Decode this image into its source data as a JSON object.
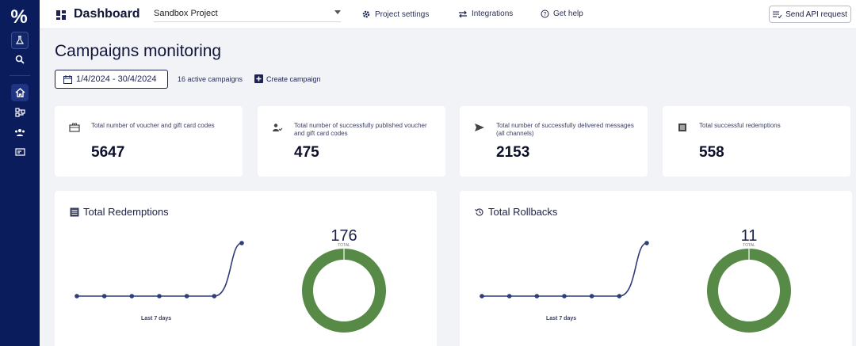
{
  "sidebar": {
    "logo": "%"
  },
  "topbar": {
    "title": "Dashboard",
    "project": "Sandbox Project",
    "links": {
      "project_settings": "Project settings",
      "integrations": "Integrations",
      "get_help": "Get help"
    },
    "api_button": "Send API request"
  },
  "page": {
    "title": "Campaigns monitoring",
    "date_range": "1/4/2024 - 30/4/2024",
    "active_campaigns": "16 active campaigns",
    "create_campaign": "Create campaign"
  },
  "stats": [
    {
      "label": "Total number of voucher and gift card codes",
      "value": "5647",
      "icon": "gift-card-icon"
    },
    {
      "label": "Total number of successfully published voucher and gift card codes",
      "value": "475",
      "icon": "person-check-icon"
    },
    {
      "label": "Total number of successfully delivered messages (all channels)",
      "value": "2153",
      "icon": "send-icon"
    },
    {
      "label": "Total successful redemptions",
      "value": "558",
      "icon": "list-icon"
    }
  ],
  "charts": {
    "redemptions": {
      "title": "Total Redemptions",
      "line_label": "Last 7 days",
      "total": "176",
      "total_label": "TOTAL"
    },
    "rollbacks": {
      "title": "Total Rollbacks",
      "line_label": "Last 7 days",
      "total": "11",
      "total_label": "TOTAL"
    }
  },
  "chart_data": [
    {
      "type": "line",
      "x": [
        1,
        2,
        3,
        4,
        5,
        6,
        7
      ],
      "values": [
        0,
        0,
        0,
        0,
        0,
        0,
        176
      ],
      "xlabel": "Last 7 days"
    },
    {
      "type": "pie",
      "values": [
        176
      ],
      "total": 176,
      "total_label": "TOTAL"
    },
    {
      "type": "line",
      "x": [
        1,
        2,
        3,
        4,
        5,
        6,
        7
      ],
      "values": [
        0,
        0,
        0,
        0,
        0,
        0,
        11
      ],
      "xlabel": "Last 7 days"
    },
    {
      "type": "pie",
      "values": [
        11
      ],
      "total": 11,
      "total_label": "TOTAL"
    }
  ],
  "colors": {
    "sidebar": "#0b1c5c",
    "line": "#2f3d7a",
    "donut": "#578a46",
    "background": "#f2f3f7"
  }
}
